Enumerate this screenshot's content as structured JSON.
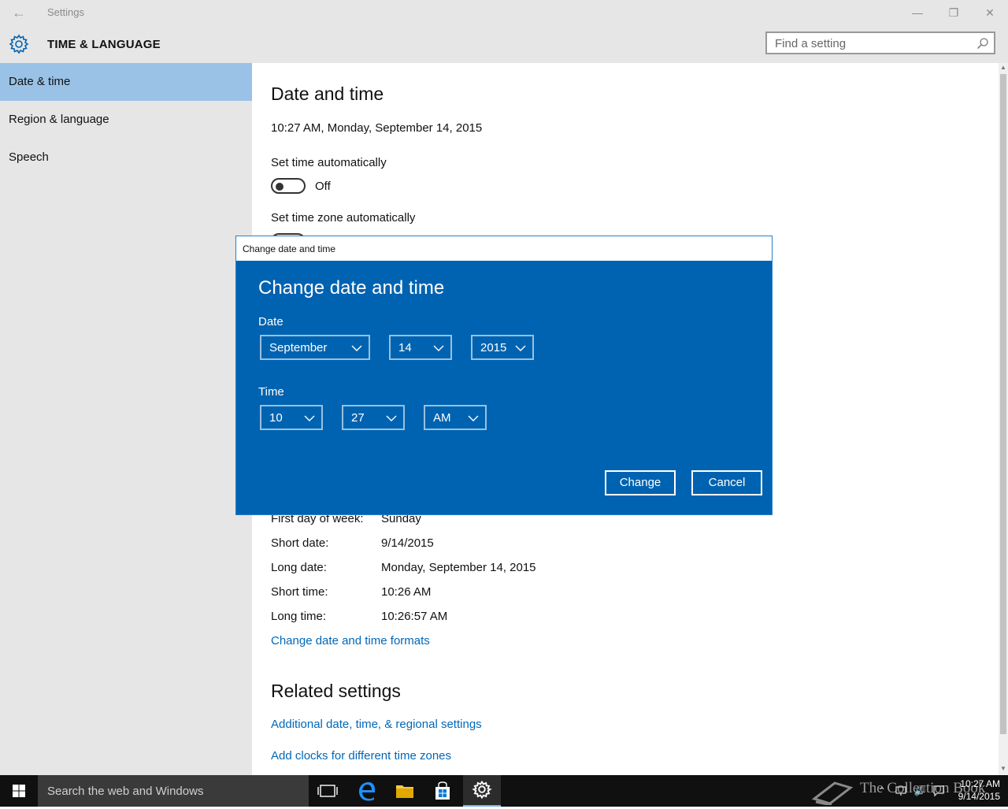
{
  "window": {
    "title": "Settings",
    "back_icon": "back-arrow-icon",
    "minimize_glyph": "—",
    "maximize_glyph": "❐",
    "close_glyph": "✕"
  },
  "header": {
    "title": "TIME & LANGUAGE",
    "search_placeholder": "Find a setting"
  },
  "sidebar": {
    "items": [
      {
        "label": "Date & time",
        "active": true
      },
      {
        "label": "Region & language",
        "active": false
      },
      {
        "label": "Speech",
        "active": false
      }
    ]
  },
  "main": {
    "heading": "Date and time",
    "current_datetime": "10:27 AM, Monday, September 14, 2015",
    "set_time_auto": {
      "label": "Set time automatically",
      "state": "Off"
    },
    "set_timezone_auto": {
      "label": "Set time zone automatically"
    },
    "formats": [
      {
        "label": "First day of week:",
        "value": "Sunday"
      },
      {
        "label": "Short date:",
        "value": "9/14/2015"
      },
      {
        "label": "Long date:",
        "value": "Monday, September 14, 2015"
      },
      {
        "label": "Short time:",
        "value": "10:26 AM"
      },
      {
        "label": "Long time:",
        "value": "10:26:57 AM"
      }
    ],
    "change_formats_link": "Change date and time formats",
    "related_heading": "Related settings",
    "related_links": [
      "Additional date, time, & regional settings",
      "Add clocks for different time zones"
    ]
  },
  "dialog": {
    "titlebar": "Change date and time",
    "heading": "Change date and time",
    "date_label": "Date",
    "month": "September",
    "day": "14",
    "year": "2015",
    "time_label": "Time",
    "hour": "10",
    "minute": "27",
    "ampm": "AM",
    "change_button": "Change",
    "cancel_button": "Cancel"
  },
  "taskbar": {
    "search_placeholder": "Search the web and Windows",
    "clock_time": "10:27 AM",
    "clock_date": "9/14/2015",
    "watermark_text": "The Collection Book",
    "accent_color": "#0063b1"
  }
}
